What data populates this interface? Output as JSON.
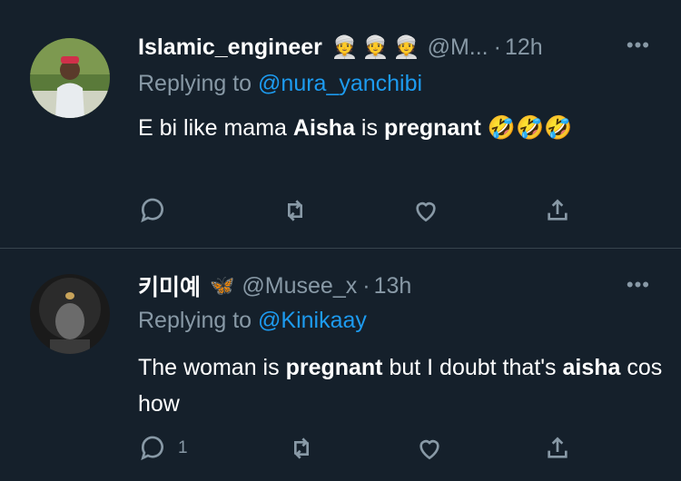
{
  "tweets": [
    {
      "name": "Islamic_engineer",
      "name_emoji": [
        "👳",
        "👳",
        "👳"
      ],
      "handle": "@M...",
      "separator": "·",
      "time": "12h",
      "replying_prefix": "Replying to",
      "replying_handle": "@nura_yanchibi",
      "body": {
        "part1": "E bi like mama ",
        "bold1": "Aisha",
        "part2": " is ",
        "bold2": "pregnant",
        "emojis": "🤣🤣🤣"
      },
      "reply_count": "",
      "icons": [
        "reply-icon",
        "retweet-icon",
        "like-icon",
        "share-icon"
      ]
    },
    {
      "name": "키미예",
      "name_emoji": [
        "🦋"
      ],
      "handle": "@Musee_x",
      "separator": "·",
      "time": "13h",
      "replying_prefix": "Replying to",
      "replying_handle": "@Kinikaay",
      "body": {
        "part1": "The woman is ",
        "bold1": "pregnant",
        "part2": " but I doubt that's ",
        "bold2": "aisha",
        "part3": " cos how"
      },
      "reply_count": "1",
      "icons": [
        "reply-icon",
        "retweet-icon",
        "like-icon",
        "share-icon"
      ]
    }
  ],
  "colors": {
    "background": "#15202b",
    "muted": "#8899a6",
    "link": "#1d9bf0",
    "divider": "#38444d"
  }
}
